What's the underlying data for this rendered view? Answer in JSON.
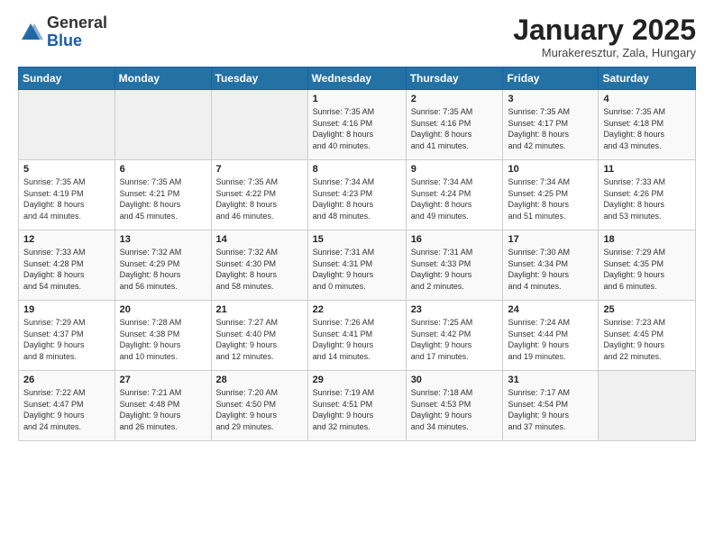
{
  "logo": {
    "general": "General",
    "blue": "Blue"
  },
  "header": {
    "month": "January 2025",
    "location": "Murakeresztur, Zala, Hungary"
  },
  "weekdays": [
    "Sunday",
    "Monday",
    "Tuesday",
    "Wednesday",
    "Thursday",
    "Friday",
    "Saturday"
  ],
  "weeks": [
    [
      {
        "day": "",
        "info": ""
      },
      {
        "day": "",
        "info": ""
      },
      {
        "day": "",
        "info": ""
      },
      {
        "day": "1",
        "info": "Sunrise: 7:35 AM\nSunset: 4:16 PM\nDaylight: 8 hours\nand 40 minutes."
      },
      {
        "day": "2",
        "info": "Sunrise: 7:35 AM\nSunset: 4:16 PM\nDaylight: 8 hours\nand 41 minutes."
      },
      {
        "day": "3",
        "info": "Sunrise: 7:35 AM\nSunset: 4:17 PM\nDaylight: 8 hours\nand 42 minutes."
      },
      {
        "day": "4",
        "info": "Sunrise: 7:35 AM\nSunset: 4:18 PM\nDaylight: 8 hours\nand 43 minutes."
      }
    ],
    [
      {
        "day": "5",
        "info": "Sunrise: 7:35 AM\nSunset: 4:19 PM\nDaylight: 8 hours\nand 44 minutes."
      },
      {
        "day": "6",
        "info": "Sunrise: 7:35 AM\nSunset: 4:21 PM\nDaylight: 8 hours\nand 45 minutes."
      },
      {
        "day": "7",
        "info": "Sunrise: 7:35 AM\nSunset: 4:22 PM\nDaylight: 8 hours\nand 46 minutes."
      },
      {
        "day": "8",
        "info": "Sunrise: 7:34 AM\nSunset: 4:23 PM\nDaylight: 8 hours\nand 48 minutes."
      },
      {
        "day": "9",
        "info": "Sunrise: 7:34 AM\nSunset: 4:24 PM\nDaylight: 8 hours\nand 49 minutes."
      },
      {
        "day": "10",
        "info": "Sunrise: 7:34 AM\nSunset: 4:25 PM\nDaylight: 8 hours\nand 51 minutes."
      },
      {
        "day": "11",
        "info": "Sunrise: 7:33 AM\nSunset: 4:26 PM\nDaylight: 8 hours\nand 53 minutes."
      }
    ],
    [
      {
        "day": "12",
        "info": "Sunrise: 7:33 AM\nSunset: 4:28 PM\nDaylight: 8 hours\nand 54 minutes."
      },
      {
        "day": "13",
        "info": "Sunrise: 7:32 AM\nSunset: 4:29 PM\nDaylight: 8 hours\nand 56 minutes."
      },
      {
        "day": "14",
        "info": "Sunrise: 7:32 AM\nSunset: 4:30 PM\nDaylight: 8 hours\nand 58 minutes."
      },
      {
        "day": "15",
        "info": "Sunrise: 7:31 AM\nSunset: 4:31 PM\nDaylight: 9 hours\nand 0 minutes."
      },
      {
        "day": "16",
        "info": "Sunrise: 7:31 AM\nSunset: 4:33 PM\nDaylight: 9 hours\nand 2 minutes."
      },
      {
        "day": "17",
        "info": "Sunrise: 7:30 AM\nSunset: 4:34 PM\nDaylight: 9 hours\nand 4 minutes."
      },
      {
        "day": "18",
        "info": "Sunrise: 7:29 AM\nSunset: 4:35 PM\nDaylight: 9 hours\nand 6 minutes."
      }
    ],
    [
      {
        "day": "19",
        "info": "Sunrise: 7:29 AM\nSunset: 4:37 PM\nDaylight: 9 hours\nand 8 minutes."
      },
      {
        "day": "20",
        "info": "Sunrise: 7:28 AM\nSunset: 4:38 PM\nDaylight: 9 hours\nand 10 minutes."
      },
      {
        "day": "21",
        "info": "Sunrise: 7:27 AM\nSunset: 4:40 PM\nDaylight: 9 hours\nand 12 minutes."
      },
      {
        "day": "22",
        "info": "Sunrise: 7:26 AM\nSunset: 4:41 PM\nDaylight: 9 hours\nand 14 minutes."
      },
      {
        "day": "23",
        "info": "Sunrise: 7:25 AM\nSunset: 4:42 PM\nDaylight: 9 hours\nand 17 minutes."
      },
      {
        "day": "24",
        "info": "Sunrise: 7:24 AM\nSunset: 4:44 PM\nDaylight: 9 hours\nand 19 minutes."
      },
      {
        "day": "25",
        "info": "Sunrise: 7:23 AM\nSunset: 4:45 PM\nDaylight: 9 hours\nand 22 minutes."
      }
    ],
    [
      {
        "day": "26",
        "info": "Sunrise: 7:22 AM\nSunset: 4:47 PM\nDaylight: 9 hours\nand 24 minutes."
      },
      {
        "day": "27",
        "info": "Sunrise: 7:21 AM\nSunset: 4:48 PM\nDaylight: 9 hours\nand 26 minutes."
      },
      {
        "day": "28",
        "info": "Sunrise: 7:20 AM\nSunset: 4:50 PM\nDaylight: 9 hours\nand 29 minutes."
      },
      {
        "day": "29",
        "info": "Sunrise: 7:19 AM\nSunset: 4:51 PM\nDaylight: 9 hours\nand 32 minutes."
      },
      {
        "day": "30",
        "info": "Sunrise: 7:18 AM\nSunset: 4:53 PM\nDaylight: 9 hours\nand 34 minutes."
      },
      {
        "day": "31",
        "info": "Sunrise: 7:17 AM\nSunset: 4:54 PM\nDaylight: 9 hours\nand 37 minutes."
      },
      {
        "day": "",
        "info": ""
      }
    ]
  ]
}
